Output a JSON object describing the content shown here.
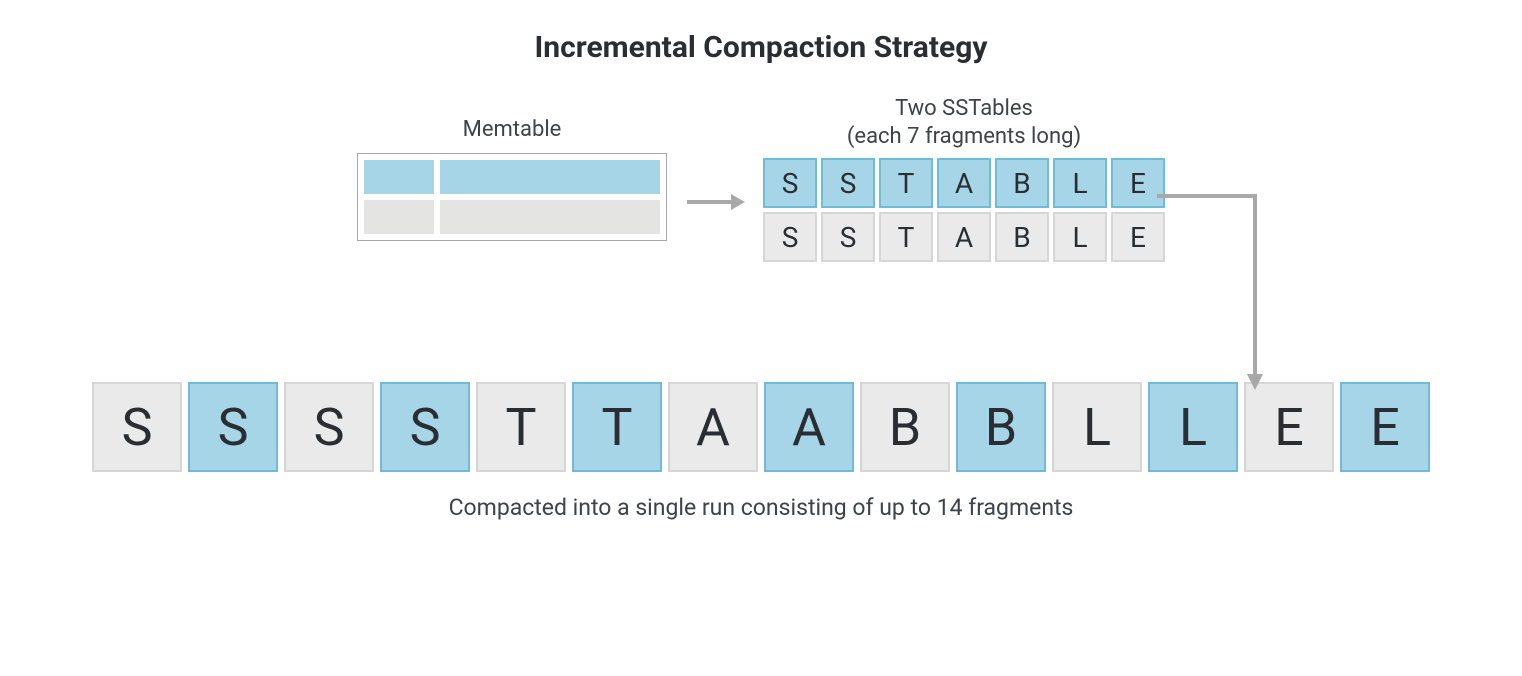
{
  "title": "Incremental Compaction Strategy",
  "memtable": {
    "label": "Memtable"
  },
  "sstables": {
    "label_line1": "Two SSTables",
    "label_line2": "(each 7 fragments long)",
    "row1": [
      "S",
      "S",
      "T",
      "A",
      "B",
      "L",
      "E"
    ],
    "row2": [
      "S",
      "S",
      "T",
      "A",
      "B",
      "L",
      "E"
    ]
  },
  "compacted": {
    "cells": [
      {
        "t": "S",
        "c": "gray"
      },
      {
        "t": "S",
        "c": "blue"
      },
      {
        "t": "S",
        "c": "gray"
      },
      {
        "t": "S",
        "c": "blue"
      },
      {
        "t": "T",
        "c": "gray"
      },
      {
        "t": "T",
        "c": "blue"
      },
      {
        "t": "A",
        "c": "gray"
      },
      {
        "t": "A",
        "c": "blue"
      },
      {
        "t": "B",
        "c": "gray"
      },
      {
        "t": "B",
        "c": "blue"
      },
      {
        "t": "L",
        "c": "gray"
      },
      {
        "t": "L",
        "c": "blue"
      },
      {
        "t": "E",
        "c": "gray"
      },
      {
        "t": "E",
        "c": "blue"
      }
    ],
    "caption": "Compacted into a single run consisting of up to 14 fragments"
  },
  "colors": {
    "blue_fill": "#a6d5e8",
    "blue_border": "#6dbdd9",
    "gray_fill": "#eaeaea",
    "gray_border": "#d6d6d5",
    "arrow": "#a8a8a8"
  }
}
